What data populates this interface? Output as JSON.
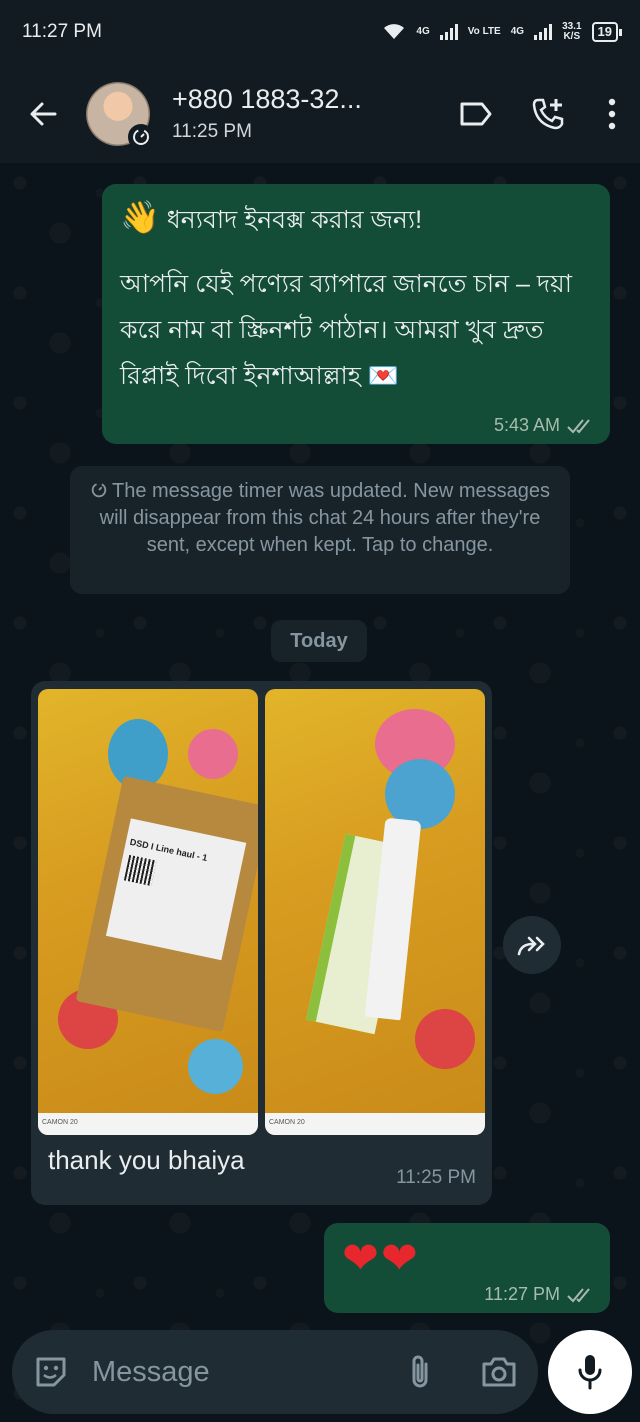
{
  "status_bar": {
    "time": "11:27 PM",
    "network_1": "4G",
    "volte": "Vo LTE",
    "network_2": "4G",
    "speed_value": "33.1",
    "speed_unit": "K/S",
    "battery": "19"
  },
  "header": {
    "contact_name": "+880 1883-32...",
    "last_seen": "11:25 PM"
  },
  "messages": [
    {
      "direction": "outgoing",
      "emoji": "👋",
      "line1": "ধন্যবাদ ইনবক্স করার জন্য!",
      "body": "আপনি যেই পণ্যের ব্যাপারে জানতে চান – দয়া করে নাম বা স্ক্রিনশট পাঠান। আমরা খুব দ্রুত রিপ্লাই দিবো ইনশাআল্লাহ 💌",
      "time": "5:43 AM"
    },
    {
      "direction": "incoming",
      "caption": "thank you bhaiya",
      "time": "11:25 PM",
      "photo_1_labels": [
        "DSD I Line haul - 1",
        "CAMON 20"
      ],
      "photo_2_labels": [
        "CAMON 20"
      ]
    },
    {
      "direction": "outgoing",
      "text": "❤❤",
      "time": "11:27 PM"
    }
  ],
  "system_notice": "The message timer was updated. New messages will disappear from this chat 24 hours after they're sent, except when kept. Tap to change.",
  "date_chip": "Today",
  "composer": {
    "placeholder": "Message"
  },
  "colors": {
    "outgoing_bubble": "#144d37",
    "incoming_bubble": "#1f2c34",
    "header_bg": "#121b22",
    "chat_bg": "#0b141a"
  },
  "icons": [
    "back-arrow-icon",
    "disappearing-timer-icon",
    "label-icon",
    "add-call-icon",
    "more-icon",
    "double-check-icon",
    "forward-icon",
    "sticker-icon",
    "attach-icon",
    "camera-icon",
    "mic-icon"
  ]
}
